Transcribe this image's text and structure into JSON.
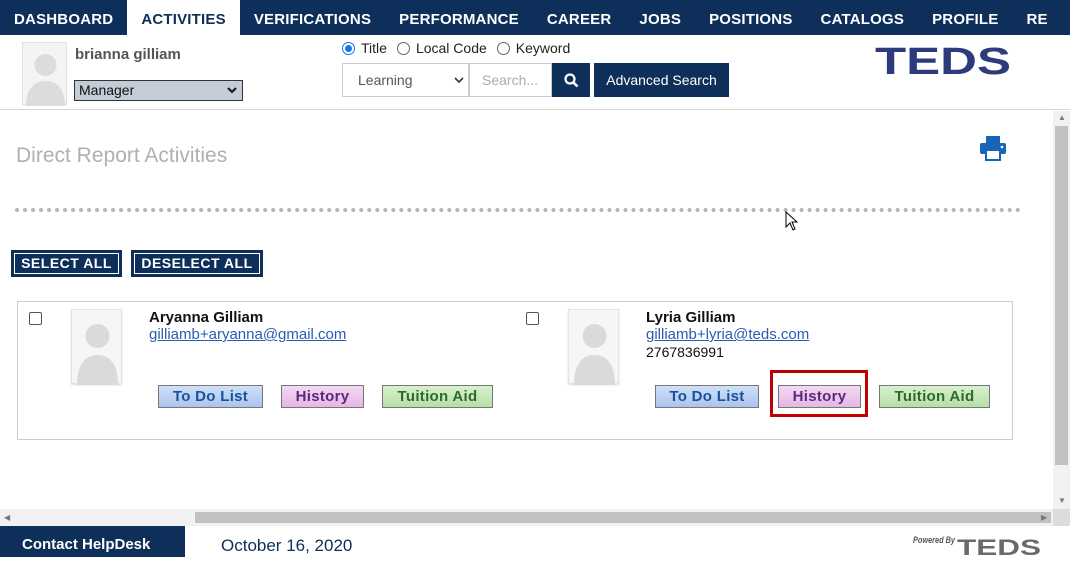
{
  "nav": {
    "items": [
      "DASHBOARD",
      "ACTIVITIES",
      "VERIFICATIONS",
      "PERFORMANCE",
      "CAREER",
      "JOBS",
      "POSITIONS",
      "CATALOGS",
      "PROFILE",
      "RE"
    ],
    "active_index": 1
  },
  "header": {
    "user_name": "brianna gilliam",
    "role": "Manager",
    "search_modes": [
      "Title",
      "Local Code",
      "Keyword"
    ],
    "selected_mode": "Title",
    "search_type": "Learning",
    "search_placeholder": "Search...",
    "advanced_search_label": "Advanced Search",
    "logo_text": "TEDS"
  },
  "main": {
    "page_title": "Direct Report Activities",
    "select_all_label": "SELECT ALL",
    "deselect_all_label": "DESELECT ALL"
  },
  "reports": [
    {
      "name": "Aryanna Gilliam",
      "email": "gilliamb+aryanna@gmail.com",
      "phone": "",
      "buttons": {
        "todo": "To Do List",
        "history": "History",
        "tuition": "Tuition Aid"
      }
    },
    {
      "name": "Lyria Gilliam",
      "email": "gilliamb+lyria@teds.com",
      "phone": "2767836991",
      "buttons": {
        "todo": "To Do List",
        "history": "History",
        "tuition": "Tuition Aid"
      }
    }
  ],
  "footer": {
    "helpdesk_label": "Contact HelpDesk",
    "date": "October 16, 2020",
    "powered_by": "Powered By",
    "powered_logo": "TEDS"
  },
  "colors": {
    "primary": "#0e2f5a",
    "highlight": "#c00000"
  }
}
